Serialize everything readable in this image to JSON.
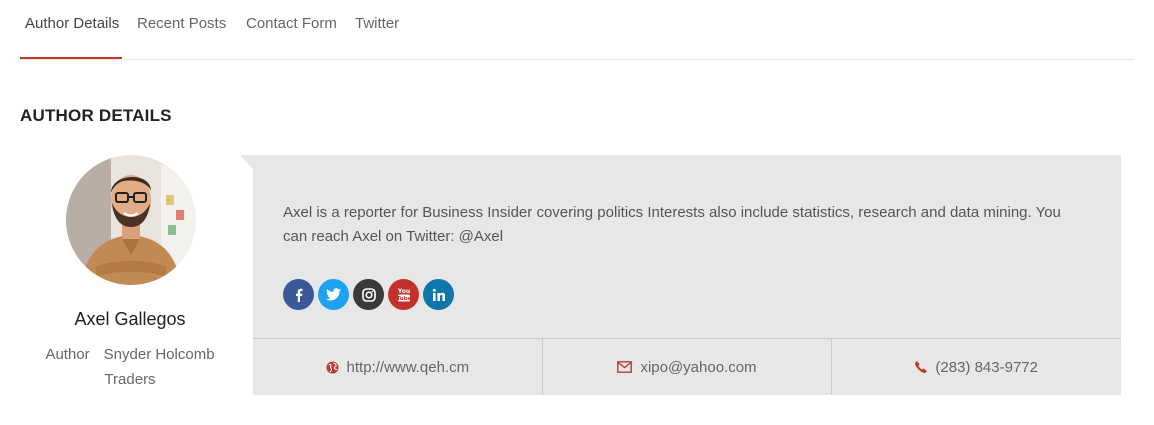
{
  "tabs": [
    {
      "label": "Author Details",
      "active": true
    },
    {
      "label": "Recent Posts",
      "active": false
    },
    {
      "label": "Contact Form",
      "active": false
    },
    {
      "label": "Twitter",
      "active": false
    }
  ],
  "section": {
    "title": "AUTHOR DETAILS"
  },
  "author": {
    "name": "Axel Gallegos",
    "role": "Author",
    "company": "Snyder Holcomb Traders"
  },
  "bio": "Axel is a reporter for Business Insider covering politics Interests also include statistics, research and data mining. You can reach Axel on Twitter: @Axel",
  "socials": [
    {
      "icon": "facebook-icon",
      "color": "#3b5998"
    },
    {
      "icon": "twitter-icon",
      "color": "#1da1f2"
    },
    {
      "icon": "instagram-icon",
      "color": "#3a3a3a"
    },
    {
      "icon": "youtube-icon",
      "color": "#c4302b"
    },
    {
      "icon": "linkedin-icon",
      "color": "#0e76a8"
    }
  ],
  "contacts": {
    "website": "http://www.qeh.cm",
    "email": "xipo@yahoo.com",
    "phone": "(283) 843-9772"
  },
  "colors": {
    "accent": "#c0392b",
    "card": "#e7e7e7"
  }
}
